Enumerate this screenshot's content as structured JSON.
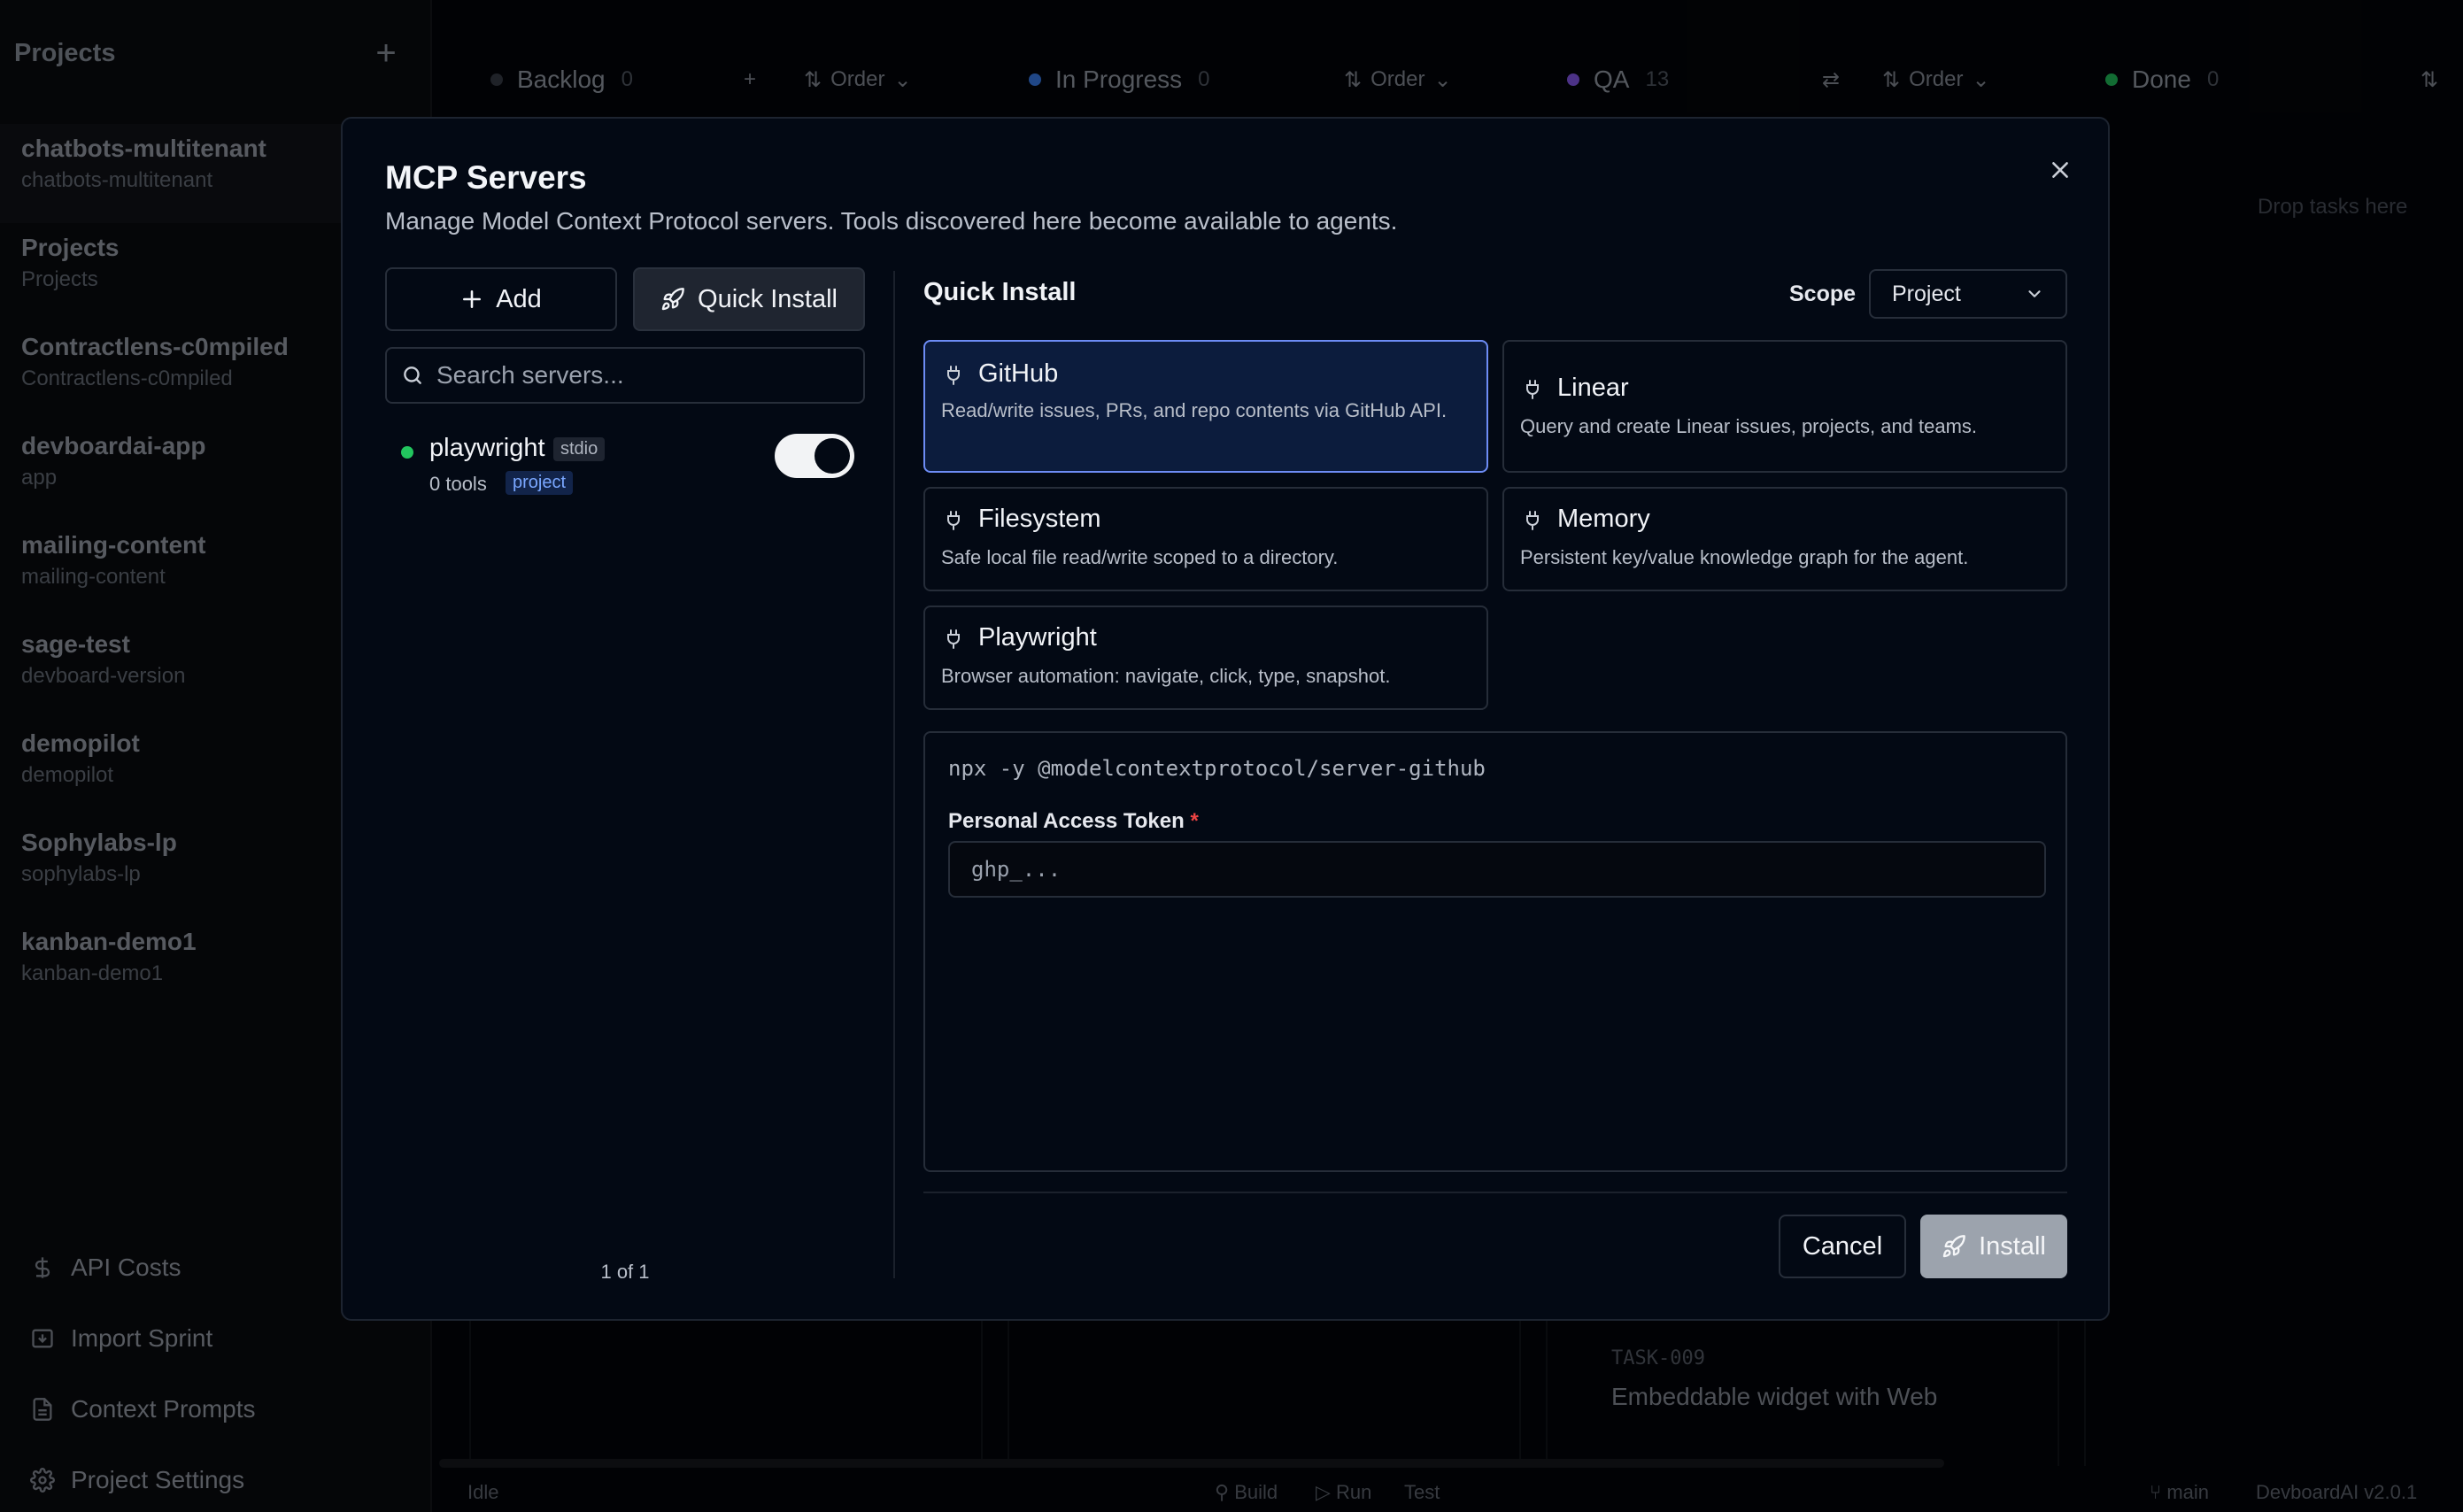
{
  "sidebar": {
    "title": "Projects",
    "projects": [
      {
        "name": "chatbots-multitenant",
        "sub": "chatbots-multitenant"
      },
      {
        "name": "Projects",
        "sub": "Projects"
      },
      {
        "name": "Contractlens-c0mpiled",
        "sub": "Contractlens-c0mpiled"
      },
      {
        "name": "devboardai-app",
        "sub": "app"
      },
      {
        "name": "mailing-content",
        "sub": "mailing-content"
      },
      {
        "name": "sage-test",
        "sub": "devboard-version"
      },
      {
        "name": "demopilot",
        "sub": "demopilot"
      },
      {
        "name": "Sophylabs-lp",
        "sub": "sophylabs-lp"
      },
      {
        "name": "kanban-demo1",
        "sub": "kanban-demo1"
      }
    ],
    "footer": [
      {
        "label": "API Costs",
        "icon": "dollar-icon"
      },
      {
        "label": "Import Sprint",
        "icon": "import-icon"
      },
      {
        "label": "Context Prompts",
        "icon": "document-icon"
      },
      {
        "label": "Project Settings",
        "icon": "gear-icon"
      }
    ]
  },
  "board": {
    "columns": [
      {
        "name": "Backlog",
        "count": "0",
        "color": "#3a3f4a"
      },
      {
        "name": "In Progress",
        "count": "0",
        "color": "#3b82f6"
      },
      {
        "name": "QA",
        "count": "13",
        "color": "#8b5cf6"
      },
      {
        "name": "Done",
        "count": "0",
        "color": "#22c55e"
      }
    ],
    "order_label": "Order",
    "drop_hint": "Drop tasks here",
    "task": {
      "id": "TASK-009",
      "title": "Embeddable widget with Web"
    }
  },
  "statusbar": {
    "state": "Idle",
    "build": "Build",
    "run": "Run",
    "test": "Test",
    "branch": "main",
    "version": "DevboardAI v2.0.1"
  },
  "modal": {
    "title": "MCP Servers",
    "description": "Manage Model Context Protocol servers. Tools discovered here become available to agents.",
    "add_label": "Add",
    "quick_install_label": "Quick Install",
    "search_placeholder": "Search servers...",
    "servers": [
      {
        "name": "playwright",
        "transport": "stdio",
        "tools": "0 tools",
        "scope": "project",
        "enabled": true
      }
    ],
    "pager": "1 of 1",
    "quick_install": {
      "title": "Quick Install",
      "scope_label": "Scope",
      "scope_value": "Project",
      "cards": [
        {
          "name": "GitHub",
          "desc": "Read/write issues, PRs, and repo contents via GitHub API.",
          "selected": true
        },
        {
          "name": "Linear",
          "desc": "Query and create Linear issues, projects, and teams.",
          "selected": false
        },
        {
          "name": "Filesystem",
          "desc": "Safe local file read/write scoped to a directory.",
          "selected": false
        },
        {
          "name": "Memory",
          "desc": "Persistent key/value knowledge graph for the agent.",
          "selected": false
        },
        {
          "name": "Playwright",
          "desc": "Browser automation: navigate, click, type, snapshot.",
          "selected": false
        }
      ],
      "command": "npx -y @modelcontextprotocol/server-github",
      "token_label": "Personal Access Token",
      "token_required_mark": "*",
      "token_placeholder": "ghp_..."
    },
    "cancel_label": "Cancel",
    "install_label": "Install"
  }
}
